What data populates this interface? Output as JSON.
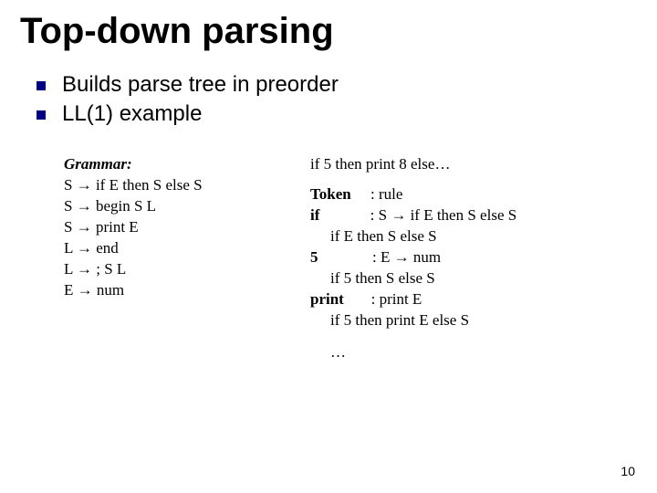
{
  "title": "Top-down parsing",
  "bullets": [
    "Builds parse tree in preorder",
    "LL(1) example"
  ],
  "grammar": {
    "heading": "Grammar:",
    "rules": [
      "S → if E then S else S",
      "S → begin S L",
      "S → print E",
      "L → end",
      "L → ; S L",
      "E → num"
    ]
  },
  "example": {
    "input": "if 5 then print 8 else…",
    "header_token": "Token",
    "header_rule": ": rule",
    "steps": [
      {
        "tok": "if",
        "rule": ": S → if E then S else S",
        "deriv": "if E then S else S"
      },
      {
        "tok": "5",
        "rule": ": E → num",
        "deriv": "if 5 then S else S"
      },
      {
        "tok": "print",
        "rule": ": print E",
        "deriv": "if 5 then print E else S"
      }
    ],
    "ellipsis": "…"
  },
  "page_number": "10"
}
